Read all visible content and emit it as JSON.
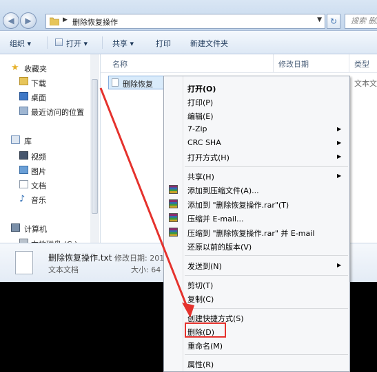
{
  "window": {
    "address_path": "删除恢复操作",
    "search_placeholder": "搜索 删除"
  },
  "toolbar": {
    "organize": "组织 ▾",
    "open": "打开 ▾",
    "share": "共享 ▾",
    "print": "打印",
    "new_folder": "新建文件夹"
  },
  "nav": {
    "favorites": "收藏夹",
    "downloads": "下载",
    "desktop": "桌面",
    "recent": "最近访问的位置",
    "libraries": "库",
    "videos": "视频",
    "pictures": "图片",
    "documents": "文档",
    "music": "音乐",
    "computer": "计算机",
    "local_disk": "本地磁盘 (C:)"
  },
  "columns": {
    "name": "名称",
    "modified": "修改日期",
    "type": "类型"
  },
  "file": {
    "name": "删除恢复",
    "type": "文本文"
  },
  "details": {
    "filename": "删除恢复操作.txt",
    "modified_label": "修改日期: 201",
    "filetype": "文本文档",
    "size_label": "大小: 64 "
  },
  "context_menu": {
    "items": [
      "打开(O)",
      "打印(P)",
      "编辑(E)",
      "7-Zip",
      "CRC SHA",
      "打开方式(H)",
      "共享(H)",
      "添加到压缩文件(A)...",
      "添加到 \"删除恢复操作.rar\"(T)",
      "压缩并 E-mail...",
      "压缩到 \"删除恢复操作.rar\" 并 E-mail",
      "还原以前的版本(V)",
      "发送到(N)",
      "剪切(T)",
      "复制(C)",
      "创建快捷方式(S)",
      "删除(D)",
      "重命名(M)",
      "属性(R)"
    ]
  },
  "colors": {
    "highlight_red": "#e5322d",
    "selection_blue": "#d9ebfb"
  }
}
